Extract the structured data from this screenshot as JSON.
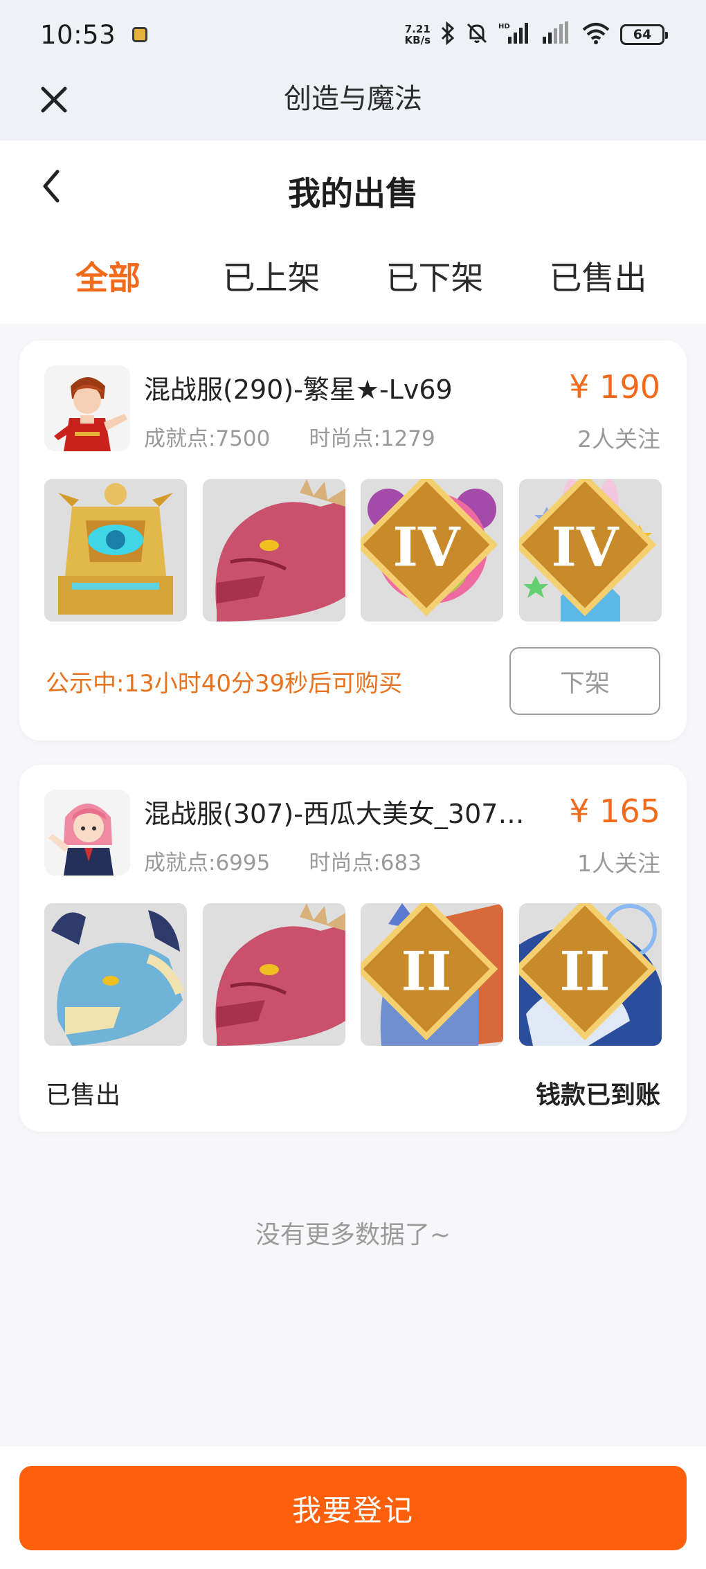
{
  "status_bar": {
    "time": "10:53",
    "net_speed_value": "7.21",
    "net_speed_unit": "KB/s",
    "hd_label": "HD",
    "battery": "64"
  },
  "webview": {
    "title": "创造与魔法"
  },
  "header": {
    "title": "我的出售"
  },
  "tabs": [
    {
      "label": "全部",
      "active": true
    },
    {
      "label": "已上架",
      "active": false
    },
    {
      "label": "已下架",
      "active": false
    },
    {
      "label": "已售出",
      "active": false
    }
  ],
  "listings": [
    {
      "role_name": "混战服(290)-繁星★-Lv69",
      "achievement": "成就点:7500",
      "fashion": "时尚点:1279",
      "price": "¥ 190",
      "followers": "2人关注",
      "items": [
        {
          "icon": "golden-throne-mount-icon",
          "tier": ""
        },
        {
          "icon": "red-dragon-head-icon",
          "tier": ""
        },
        {
          "icon": "pink-bear-pet-icon",
          "tier": "IV"
        },
        {
          "icon": "pink-rabbit-pet-icon",
          "tier": "IV"
        }
      ],
      "notice_label": "公示中:",
      "notice_text": "13小时40分39秒后可购买",
      "action_label": "下架"
    },
    {
      "role_name": "混战服(307)-西瓜大美女_307-…",
      "achievement": "成就点:6995",
      "fashion": "时尚点:683",
      "price": "¥ 165",
      "followers": "1人关注",
      "items": [
        {
          "icon": "blue-dragon-mount-icon",
          "tier": ""
        },
        {
          "icon": "red-dragon-head-icon",
          "tier": ""
        },
        {
          "icon": "griffin-bird-mount-icon",
          "tier": "II"
        },
        {
          "icon": "blue-tiger-mount-icon",
          "tier": "II"
        }
      ],
      "sold_label": "已售出",
      "payment_label": "钱款已到账"
    }
  ],
  "footer": {
    "no_more": "没有更多数据了~",
    "register_button": "我要登记"
  },
  "colors": {
    "accent": "#f26a1b",
    "button_bg": "#fd5f0a",
    "page_bg": "#f7f7f9",
    "muted_text": "#9a9a9a"
  }
}
